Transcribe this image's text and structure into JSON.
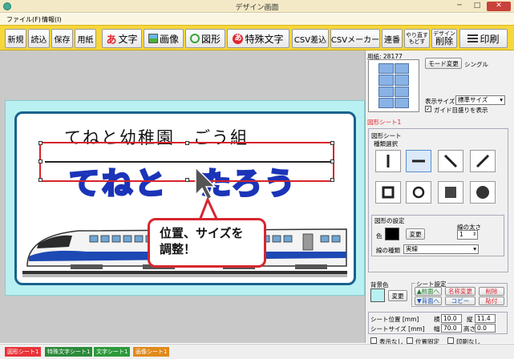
{
  "window": {
    "title": "デザイン画面",
    "minimize": "─",
    "maximize": "□",
    "close": "✕"
  },
  "menu": {
    "file": "ファイル(F)",
    "info": "情報(I)"
  },
  "toolbar": {
    "new": "新規",
    "open": "読込",
    "save": "保存",
    "paper": "用紙",
    "text": "文字",
    "image": "画像",
    "shape": "図形",
    "special_text": "特殊文字",
    "csv_insert": "CSV差込",
    "csv_maker": "CSVメーカー",
    "serial": "連番",
    "undo": "やり直す",
    "redo": "もどす",
    "design_label": "デザイン",
    "delete": "削除",
    "print": "印刷"
  },
  "canvas": {
    "line1": "てねと幼稚園　ごう組",
    "line2": "てねと　たろう",
    "callout": [
      "位置、サイズを",
      "調整！"
    ]
  },
  "sidebar": {
    "paper_label": "用紙: 28177",
    "mode_change": "モード変更",
    "mode_value": "シングル",
    "display_size_label": "表示サイズ",
    "display_size_value": "標準サイズ",
    "guide_checkbox": "ガイド目盛りを表示",
    "guide_checked": true,
    "sheet_tab": "図形シート1",
    "shape_sheet_label": "図形シート",
    "type_select_label": "種類選択",
    "shape_settings_label": "図形の設定",
    "line_width_label": "線の太さ",
    "line_width_value": "1",
    "color_label": "色",
    "change_button": "変更",
    "line_type_label": "線の種類",
    "line_type_value": "実線",
    "bg_color_label": "背景色",
    "bg_change_button": "変更",
    "sheet_settings_label": "シート設定",
    "to_front": "▲前面へ",
    "to_back": "▼背面へ",
    "rename": "名称変更",
    "copy": "コピー",
    "delete": "削除",
    "paste": "貼付",
    "sheet_pos_label": "シート位置 [mm]",
    "sheet_size_label": "シートサイズ [mm]",
    "yoko": "横",
    "tate": "縦",
    "haba": "幅",
    "takasa": "高さ",
    "pos_x": "10.0",
    "pos_y": "11.4",
    "size_w": "70.0",
    "size_h": "0.0",
    "hide": "表示なし",
    "lock_pos": "位置固定",
    "no_print": "印刷なし"
  },
  "status_tabs": [
    "図形シート1",
    "特殊文字シート1",
    "文字シート1",
    "画像シート1"
  ],
  "colors": {
    "toolbar": "#f7d63b",
    "sheet_bg": "#b9f1f2",
    "card_border": "#19628e",
    "name_outline": "#1b34b8",
    "accent_red": "#d7262f"
  }
}
